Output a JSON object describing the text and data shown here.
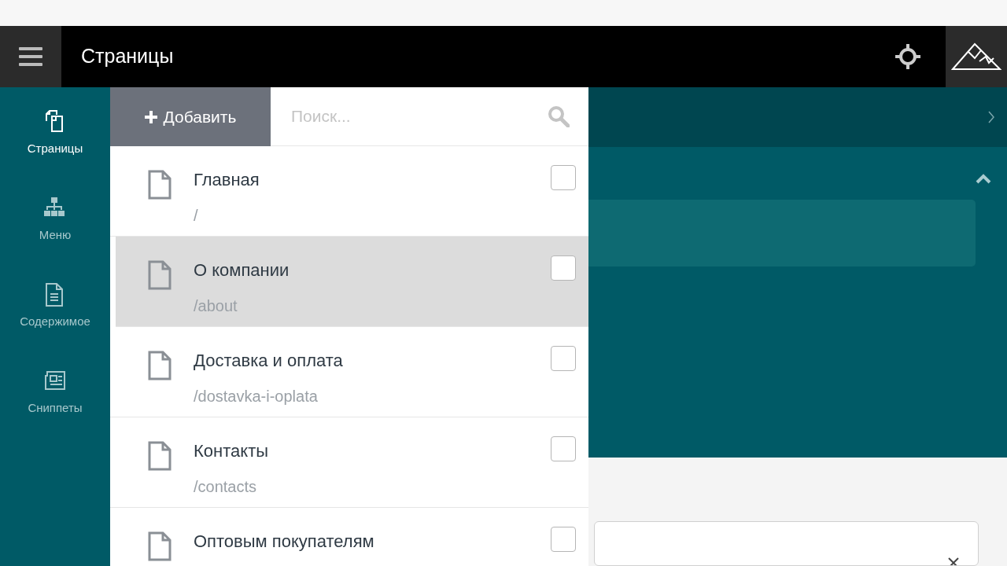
{
  "topbar": {
    "title": "Страницы"
  },
  "sidebar": {
    "items": [
      {
        "label": "Страницы",
        "kind": "pages",
        "selected": true
      },
      {
        "label": "Меню",
        "kind": "tree",
        "selected": false
      },
      {
        "label": "Содержимое",
        "kind": "document",
        "selected": false
      },
      {
        "label": "Сниппеты",
        "kind": "newspaper",
        "selected": false
      }
    ]
  },
  "pages_panel": {
    "add_button": "Добавить",
    "search": {
      "placeholder": "Поиск..."
    },
    "items": [
      {
        "title": "Главная",
        "url": "/",
        "checked": false,
        "selected": false
      },
      {
        "title": "О компании",
        "url": "/about",
        "checked": false,
        "selected": true
      },
      {
        "title": "Доставка и оплата",
        "url": "/dostavka-i-oplata",
        "checked": false,
        "selected": false
      },
      {
        "title": "Контакты",
        "url": "/contacts",
        "checked": false,
        "selected": false
      },
      {
        "title": "Оптовым покупателям",
        "checked": false,
        "selected": false
      }
    ]
  }
}
